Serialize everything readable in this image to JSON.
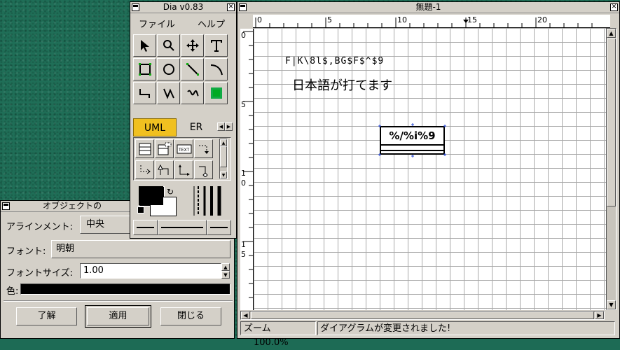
{
  "colors": {
    "desktop": "#1f6e57",
    "window_bg": "#d4d0c8",
    "uml_tab_active": "#f0c020",
    "canvas_bg": "#ffffff",
    "grid": "#a8a8a8"
  },
  "canvas_window": {
    "title": "無題-1",
    "ruler_h_labels": [
      "0",
      "5",
      "10",
      "15",
      "20"
    ],
    "ruler_v_labels": [
      "0",
      "5",
      "1",
      "0",
      "1",
      "5"
    ],
    "text_garbled": "F|K\\8l$,BG$F$^$9",
    "text_japanese": "日本語が打てます",
    "uml_class_name": "%/%i%9",
    "status_zoom_label": "ズーム",
    "status_zoom_value": "100.0%",
    "status_message": "ダイアグラムが変更されました!"
  },
  "toolbox": {
    "title": "Dia v0.83",
    "menu": [
      "ファイル",
      "ヘルプ"
    ],
    "tools": [
      {
        "icon": "pointer-icon"
      },
      {
        "icon": "magnify-icon"
      },
      {
        "icon": "move-icon"
      },
      {
        "icon": "text-tool-icon"
      },
      {
        "icon": "box-icon"
      },
      {
        "icon": "ellipse-icon"
      },
      {
        "icon": "line-icon"
      },
      {
        "icon": "arc-icon"
      },
      {
        "icon": "zigzag-icon"
      },
      {
        "icon": "polyline-icon"
      },
      {
        "icon": "bezier-icon"
      },
      {
        "icon": "image-icon"
      }
    ],
    "sheet_tabs": [
      "UML",
      "ER"
    ],
    "sheet_tool_text": "TEXT"
  },
  "properties_dialog": {
    "title": "オブジェクトの",
    "alignment_label": "アラインメント:",
    "alignment_value": "中央",
    "font_label": "フォント:",
    "font_value": "明朝",
    "font_size_label": "フォントサイズ:",
    "font_size_value": "1.00",
    "color_label": "色:",
    "buttons": {
      "ok": "了解",
      "apply": "適用",
      "close": "閉じる"
    }
  }
}
